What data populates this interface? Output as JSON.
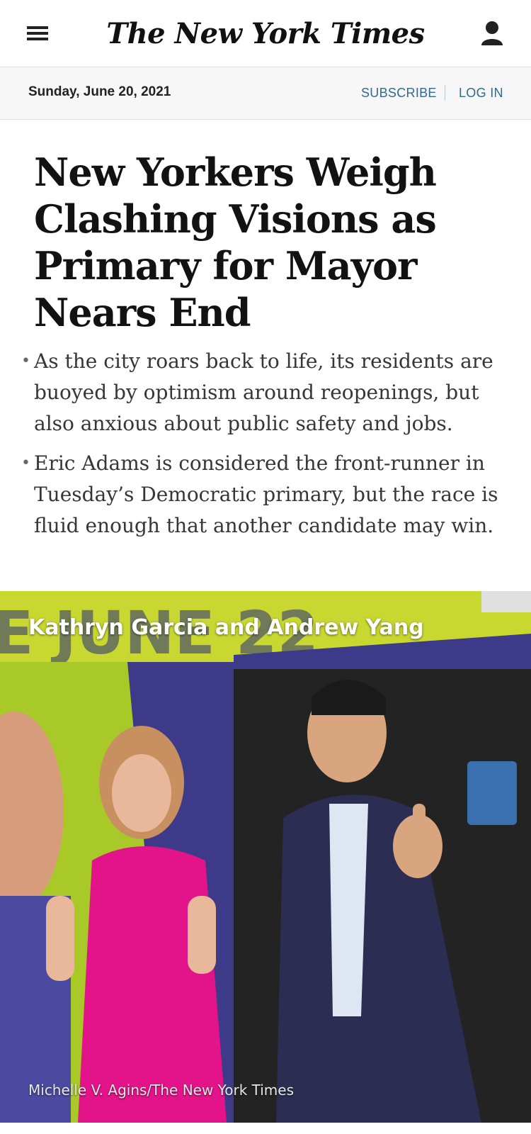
{
  "header": {
    "logo_text": "The New York Times",
    "menu_icon": "hamburger-menu-icon",
    "account_icon": "person-icon"
  },
  "datebar": {
    "date": "Sunday, June 20, 2021",
    "subscribe_label": "SUBSCRIBE",
    "login_label": "LOG IN"
  },
  "article": {
    "headline": "New Yorkers Weigh Clashing Visions as Primary for Mayor Nears End",
    "summary": [
      "As the city roars back to life, its residents are buoyed by optimism around reopenings, but also anxious about public safety and jobs.",
      "Eric Adams is considered the front-runner in Tuesday’s Democratic primary, but the race is fluid enough that another candidate may win."
    ],
    "bullet": "•",
    "image": {
      "caption": "Kathryn Garcia and Andrew Yang",
      "credit": "Michelle V. Agins/The New York Times",
      "banner_text": "E JUNE 22"
    }
  },
  "colors": {
    "link": "#326891",
    "headline": "#121212",
    "summary_text": "#363636",
    "datebar_bg": "#f7f7f7"
  }
}
